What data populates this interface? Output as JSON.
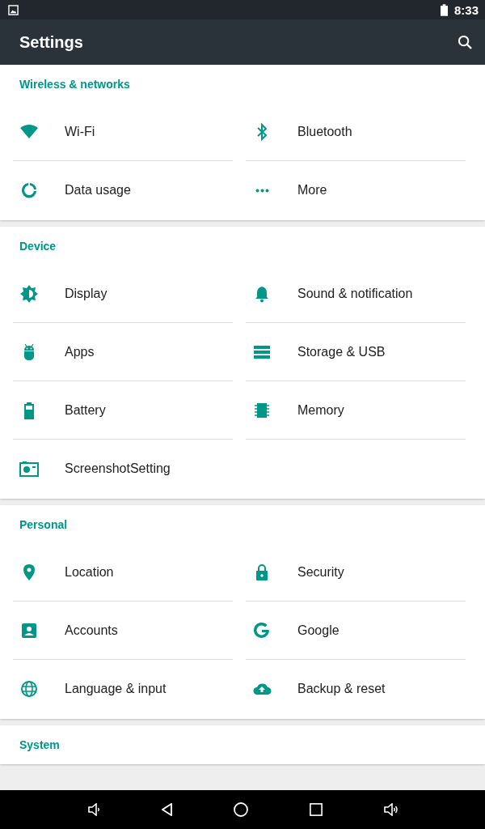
{
  "status_bar": {
    "time": "8:33"
  },
  "toolbar": {
    "title": "Settings"
  },
  "sections": [
    {
      "title": "Wireless & networks",
      "items": [
        {
          "label": "Wi-Fi"
        },
        {
          "label": "Bluetooth"
        },
        {
          "label": "Data usage"
        },
        {
          "label": "More"
        }
      ]
    },
    {
      "title": "Device",
      "items": [
        {
          "label": "Display"
        },
        {
          "label": "Sound & notification"
        },
        {
          "label": "Apps"
        },
        {
          "label": "Storage & USB"
        },
        {
          "label": "Battery"
        },
        {
          "label": "Memory"
        },
        {
          "label": "ScreenshotSetting"
        }
      ]
    },
    {
      "title": "Personal",
      "items": [
        {
          "label": "Location"
        },
        {
          "label": "Security"
        },
        {
          "label": "Accounts"
        },
        {
          "label": "Google"
        },
        {
          "label": "Language & input"
        },
        {
          "label": "Backup & reset"
        }
      ]
    },
    {
      "title": "System"
    }
  ]
}
